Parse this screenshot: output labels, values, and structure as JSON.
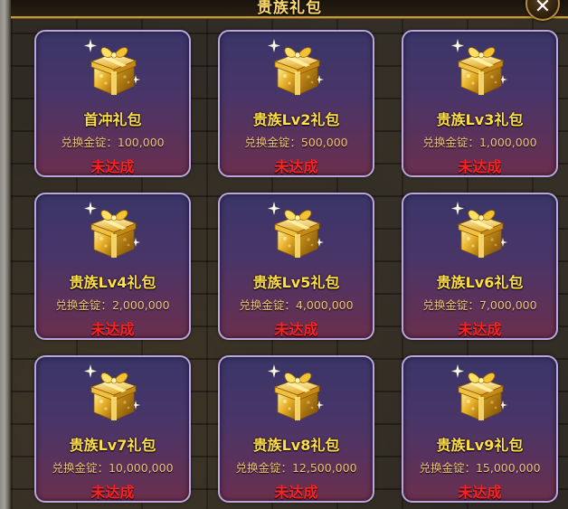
{
  "window": {
    "title": "贵族礼包",
    "close_label": "✕"
  },
  "packages": [
    {
      "name": "首冲礼包",
      "cost_label": "兑换金锭：",
      "cost": "100,000",
      "status": "未达成"
    },
    {
      "name": "贵族Lv2礼包",
      "cost_label": "兑换金锭：",
      "cost": "500,000",
      "status": "未达成"
    },
    {
      "name": "贵族Lv3礼包",
      "cost_label": "兑换金锭：",
      "cost": "1,000,000",
      "status": "未达成"
    },
    {
      "name": "贵族Lv4礼包",
      "cost_label": "兑换金锭：",
      "cost": "2,000,000",
      "status": "未达成"
    },
    {
      "name": "贵族Lv5礼包",
      "cost_label": "兑换金锭：",
      "cost": "4,000,000",
      "status": "未达成"
    },
    {
      "name": "贵族Lv6礼包",
      "cost_label": "兑换金锭：",
      "cost": "7,000,000",
      "status": "未达成"
    },
    {
      "name": "贵族Lv7礼包",
      "cost_label": "兑换金锭：",
      "cost": "10,000,000",
      "status": "未达成"
    },
    {
      "name": "贵族Lv8礼包",
      "cost_label": "兑换金锭：",
      "cost": "12,500,000",
      "status": "未达成"
    },
    {
      "name": "贵族Lv9礼包",
      "cost_label": "兑换金锭：",
      "cost": "15,000,000",
      "status": "未达成"
    }
  ],
  "icons": {
    "gift": "gift-box-icon",
    "close": "close-icon"
  },
  "colors": {
    "name": "#ffde4a",
    "cost": "#f3c57a",
    "status_unmet": "#ff2020",
    "card_border": "#b9a5df"
  }
}
